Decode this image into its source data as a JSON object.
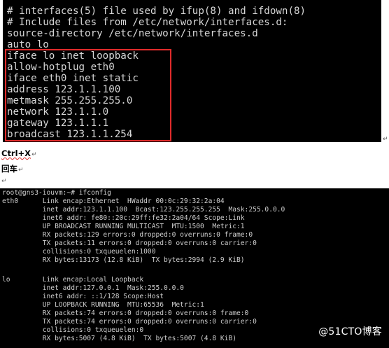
{
  "top_terminal": {
    "lines": [
      "# interfaces(5) file used by ifup(8) and ifdown(8)",
      "# Include files from /etc/network/interfaces.d:",
      "source-directory /etc/network/interfaces.d",
      "auto lo",
      "iface lo inet loopback",
      "allow-hotplug eth0",
      "iface eth0 inet static",
      "address 123.1.1.100",
      "metmask 255.255.255.0",
      "network 123.1.1.0",
      "gateway 123.1.1.1",
      "broadcast 123.1.1.254"
    ],
    "highlight_color": "#e02b2b"
  },
  "doc": {
    "line1": "Ctrl+X",
    "line2": "回车",
    "paragraph_mark": "↵"
  },
  "bottom_terminal": {
    "lines": [
      "root@gns3-iouvm:~# ifconfig",
      "eth0      Link encap:Ethernet  HWaddr 00:0c:29:32:2a:04",
      "          inet addr:123.1.1.100  Bcast:123.255.255.255  Mask:255.0.0.0",
      "          inet6 addr: fe80::20c:29ff:fe32:2a04/64 Scope:Link",
      "          UP BROADCAST RUNNING MULTICAST  MTU:1500  Metric:1",
      "          RX packets:129 errors:0 dropped:0 overruns:0 frame:0",
      "          TX packets:11 errors:0 dropped:0 overruns:0 carrier:0",
      "          collisions:0 txqueuelen:1000",
      "          RX bytes:13173 (12.8 KiB)  TX bytes:2994 (2.9 KiB)",
      "",
      "lo        Link encap:Local Loopback",
      "          inet addr:127.0.0.1  Mask:255.0.0.0",
      "          inet6 addr: ::1/128 Scope:Host",
      "          UP LOOPBACK RUNNING  MTU:65536  Metric:1",
      "          RX packets:74 errors:0 dropped:0 overruns:0 frame:0",
      "          TX packets:74 errors:0 dropped:0 overruns:0 carrier:0",
      "          collisions:0 txqueuelen:0",
      "          RX bytes:5007 (4.8 KiB)  TX bytes:5007 (4.8 KiB)"
    ]
  },
  "watermark": "@51CTO博客"
}
